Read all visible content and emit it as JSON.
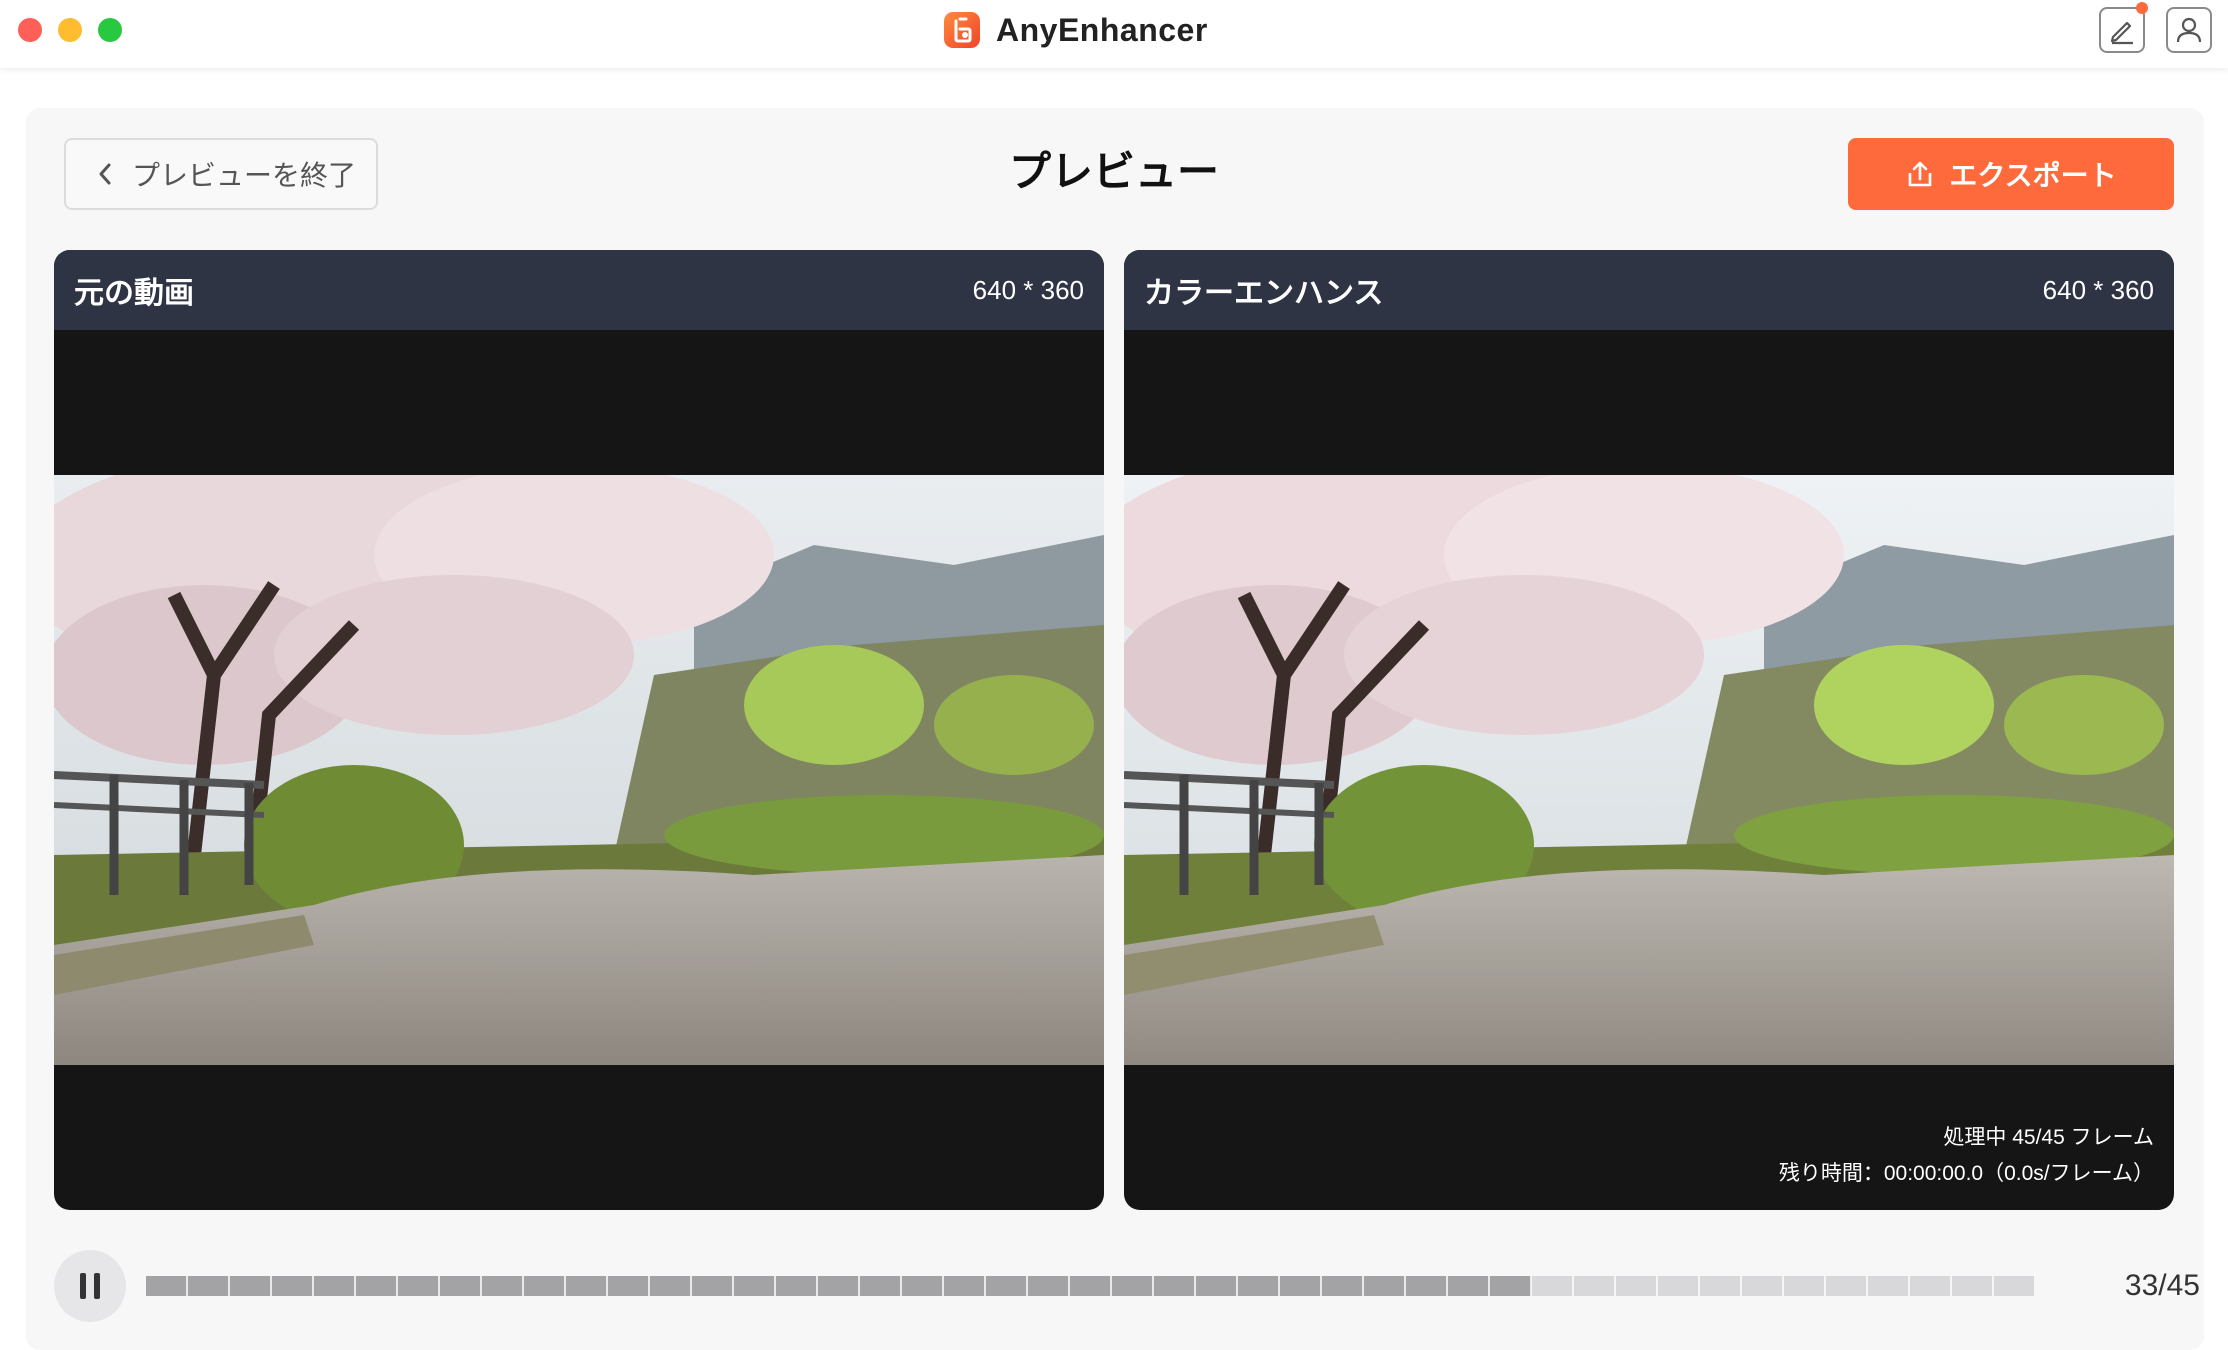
{
  "app": {
    "title": "AnyEnhancer",
    "brand_color": "#ff6a3d"
  },
  "titlebar": {
    "icons": [
      "edit-icon",
      "user-icon"
    ]
  },
  "header": {
    "back_label": "プレビューを終了",
    "page_title": "プレビュー",
    "export_label": "エクスポート"
  },
  "videos": {
    "original": {
      "title": "元の動画",
      "resolution": "640 * 360"
    },
    "enhanced": {
      "title": "カラーエンハンス",
      "resolution": "640 * 360",
      "processing": "処理中 45/45 フレーム",
      "remaining": "残り時間：00:00:00.0（0.0s/フレーム）"
    }
  },
  "playback": {
    "state_icon": "pause-icon",
    "current_frame": 33,
    "total_frames": 45,
    "counter": "33/45"
  }
}
